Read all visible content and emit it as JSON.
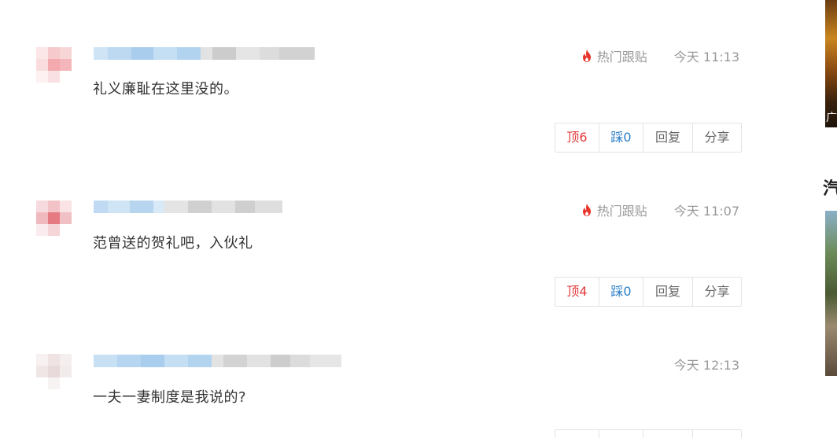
{
  "comments": [
    {
      "content": "礼义廉耻在这里没的。",
      "hot_label": "热门跟贴",
      "time": "今天 11:13",
      "up_label": "顶6",
      "down_label": "踩0",
      "reply_label": "回复",
      "share_label": "分享"
    },
    {
      "content": "范曾送的贺礼吧，入伙礼",
      "hot_label": "热门跟贴",
      "time": "今天 11:07",
      "up_label": "顶4",
      "down_label": "踩0",
      "reply_label": "回复",
      "share_label": "分享"
    },
    {
      "content": "一夫一妻制度是我说的?",
      "time": "今天 12:13"
    }
  ],
  "sidebar": {
    "title_fragment": "汽",
    "image_caption_fragment": "广"
  },
  "colors": {
    "up": "#e33b3b",
    "down": "#2a7fc7",
    "hot_icon": "#e8352c",
    "meta_text": "#999999"
  },
  "icons": {
    "hot": "flame-icon"
  }
}
